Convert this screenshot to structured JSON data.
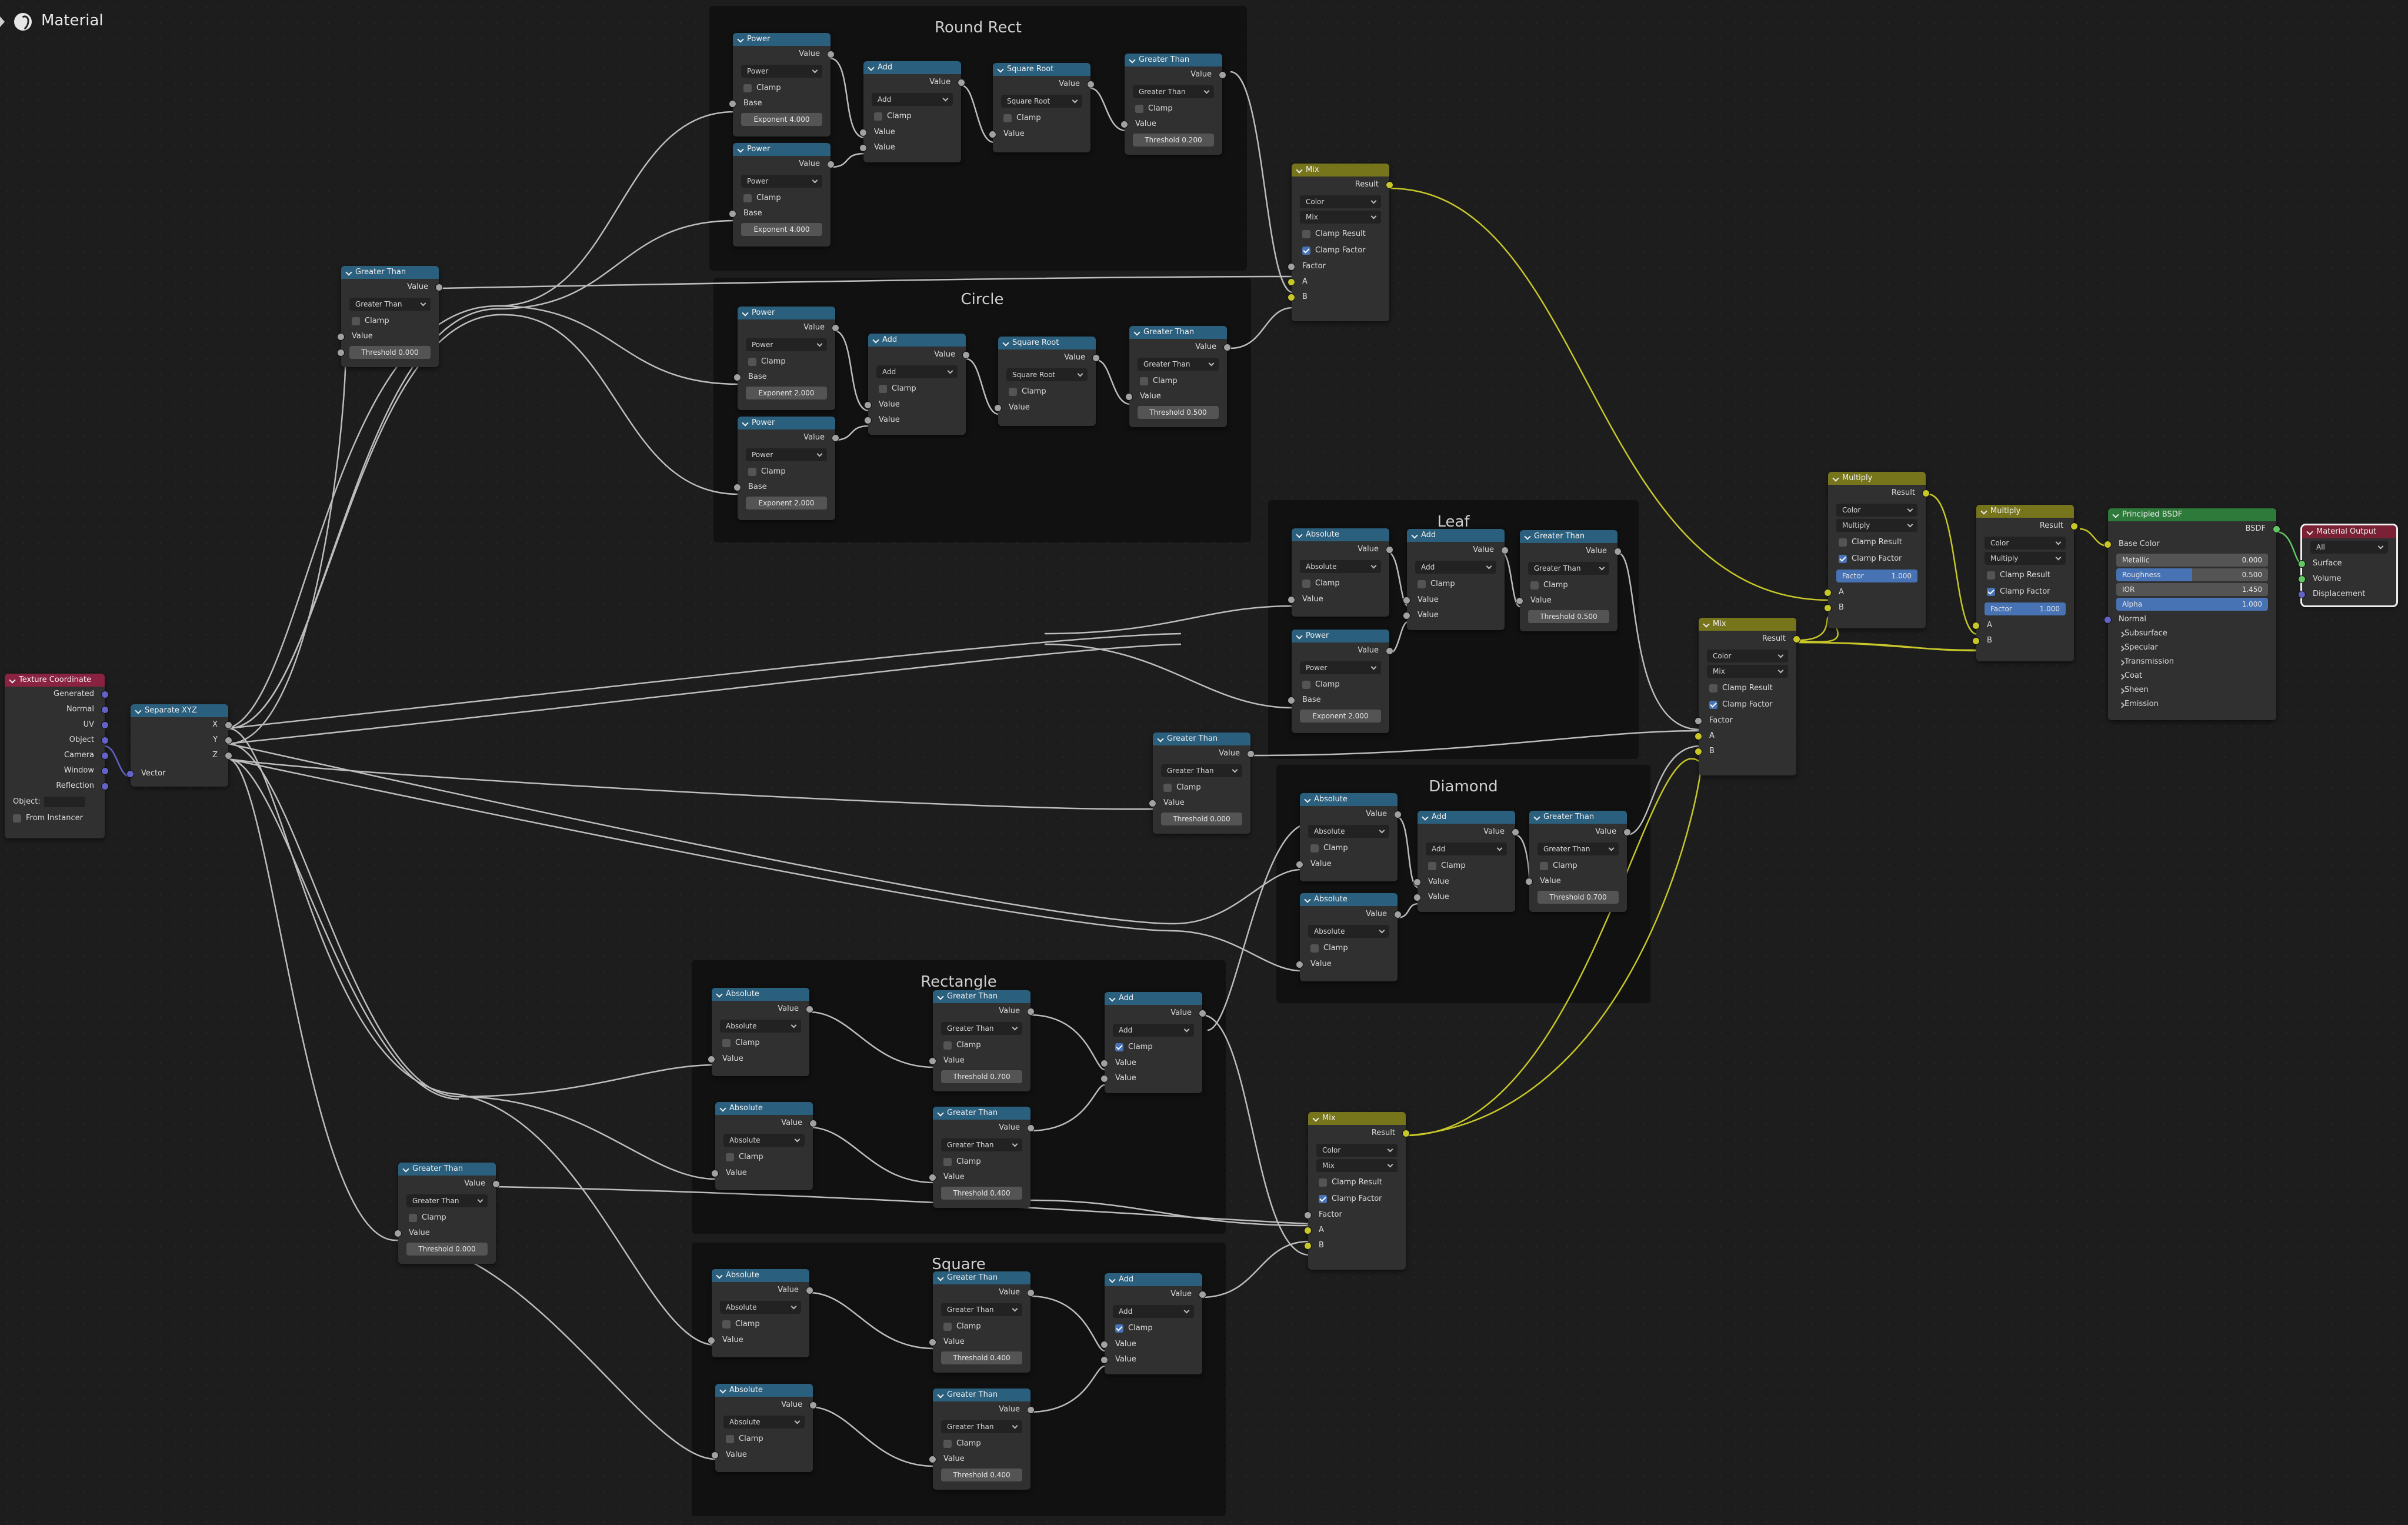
{
  "header": {
    "title": "Material"
  },
  "frames": {
    "round_rect": "Round Rect",
    "circle": "Circle",
    "leaf": "Leaf",
    "diamond": "Diamond",
    "rectangle": "Rectangle",
    "square": "Square"
  },
  "common": {
    "power": "Power",
    "add": "Add",
    "square_root": "Square Root",
    "greater_than": "Greater Than",
    "absolute": "Absolute",
    "clamp": "Clamp",
    "value": "Value",
    "base": "Base",
    "mix": "Mix",
    "multiply": "Multiply",
    "result": "Result",
    "color": "Color",
    "clamp_result": "Clamp Result",
    "clamp_factor": "Clamp Factor",
    "factor": "Factor",
    "a": "A",
    "b": "B"
  },
  "values": {
    "exp4": "Exponent   4.000",
    "exp2": "Exponent   2.000",
    "th_0200": "Threshold   0.200",
    "th_0500": "Threshold   0.500",
    "th_0000": "Threshold   0.000",
    "th_0700": "Threshold   0.700",
    "th_0400": "Threshold   0.400",
    "factor_label": "Factor",
    "factor_val": "1.000"
  },
  "texcoord": {
    "title": "Texture Coordinate",
    "outputs": [
      "Generated",
      "Normal",
      "UV",
      "Object",
      "Camera",
      "Window",
      "Reflection"
    ],
    "object_label": "Object:",
    "from_instancer": "From Instancer"
  },
  "separate": {
    "title": "Separate XYZ",
    "x": "X",
    "y": "Y",
    "z": "Z",
    "vector": "Vector"
  },
  "bsdf": {
    "title": "Principled BSDF",
    "out": "BSDF",
    "base_color": "Base Color",
    "metallic": "Metallic",
    "metallic_val": "0.000",
    "roughness": "Roughness",
    "roughness_val": "0.500",
    "ior": "IOR",
    "ior_val": "1.450",
    "alpha": "Alpha",
    "alpha_val": "1.000",
    "normal": "Normal",
    "panels": [
      "Subsurface",
      "Specular",
      "Transmission",
      "Coat",
      "Sheen",
      "Emission"
    ]
  },
  "matout": {
    "title": "Material Output",
    "target": "All",
    "surface": "Surface",
    "volume": "Volume",
    "displacement": "Displacement"
  },
  "colors": {
    "math_header": "#2a5f7e",
    "mix_header": "#77751c",
    "shader_header": "#2e7a3a",
    "input_header": "#8a2241",
    "link_float": "#bdbdbd",
    "link_color": "#c7c729"
  }
}
